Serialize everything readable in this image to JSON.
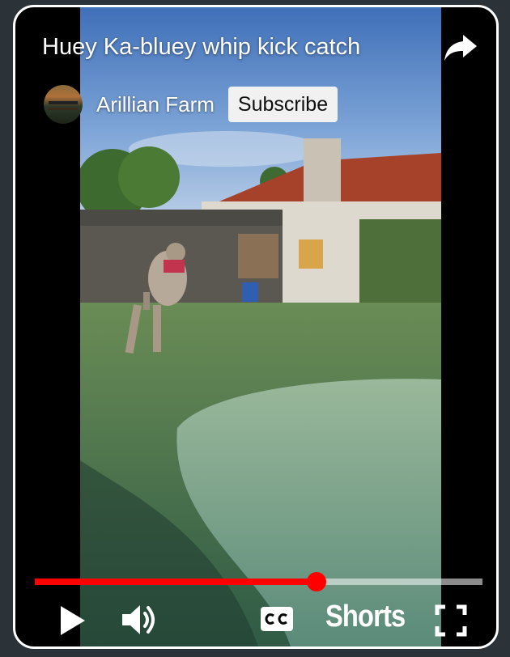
{
  "video": {
    "title": "Huey Ka-bluey whip kick catch",
    "progress": 0.63
  },
  "channel": {
    "name": "Arillian Farm",
    "subscribe_label": "Subscribe"
  },
  "controls": {
    "shorts_label": "Shorts",
    "icons": [
      "share-icon",
      "play-icon",
      "volume-icon",
      "captions-icon",
      "fullscreen-icon"
    ]
  },
  "colors": {
    "accent": "#ff0000",
    "background": "#2b3238",
    "frame_border": "#ffffff"
  }
}
